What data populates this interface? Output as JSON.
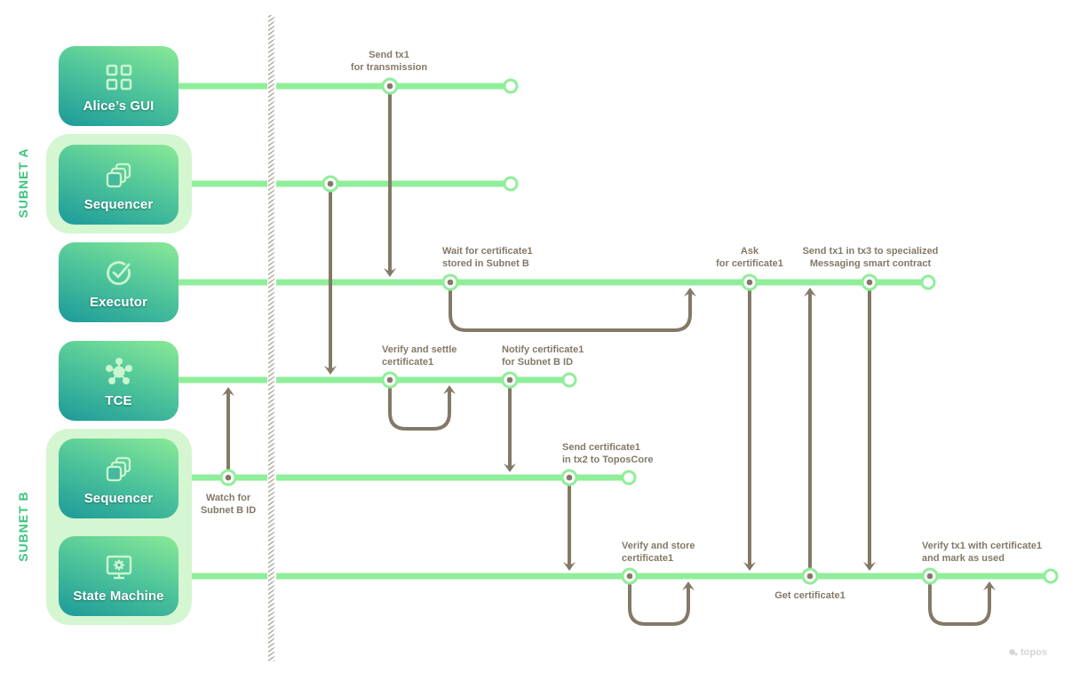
{
  "colors": {
    "lane": "#8fee9a",
    "arrow": "#837967",
    "accent": "#3cc47e",
    "group_bg": "#d4f6d0",
    "divider": "#a39c8e"
  },
  "subnets": [
    {
      "id": "subnet-a",
      "label": "SUBNET A"
    },
    {
      "id": "subnet-b",
      "label": "SUBNET B"
    }
  ],
  "actors": [
    {
      "id": "alices-gui",
      "label": "Alice’s GUI",
      "icon": "grid-icon",
      "subnet": "none"
    },
    {
      "id": "sequencer-a",
      "label": "Sequencer",
      "icon": "stack-icon",
      "subnet": "SUBNET A"
    },
    {
      "id": "executor",
      "label": "Executor",
      "icon": "check-circle-icon",
      "subnet": "none"
    },
    {
      "id": "tce",
      "label": "TCE",
      "icon": "network-hub-icon",
      "subnet": "none"
    },
    {
      "id": "sequencer-b",
      "label": "Sequencer",
      "icon": "stack-icon",
      "subnet": "SUBNET B"
    },
    {
      "id": "state-machine",
      "label": "State Machine",
      "icon": "monitor-gear-icon",
      "subnet": "SUBNET B"
    }
  ],
  "steps": [
    {
      "id": "send-tx1",
      "lane": "Alice’s GUI",
      "lines": [
        "Send tx1",
        "for transmission"
      ]
    },
    {
      "id": "wait-cert",
      "lane": "Executor",
      "lines": [
        "Wait for certificate1",
        "stored in Subnet B"
      ]
    },
    {
      "id": "ask-cert",
      "lane": "Executor",
      "lines": [
        "Ask",
        "for certificate1"
      ]
    },
    {
      "id": "send-tx3",
      "lane": "Executor",
      "lines": [
        "Send tx1 in tx3 to specialized",
        "Messaging smart contract"
      ]
    },
    {
      "id": "verify-settle",
      "lane": "TCE",
      "lines": [
        "Verify and settle",
        "certificate1"
      ]
    },
    {
      "id": "notify-cert",
      "lane": "TCE",
      "lines": [
        "Notify certificate1",
        "for Subnet B ID"
      ]
    },
    {
      "id": "watch-subnet",
      "lane": "Sequencer (Subnet B)",
      "lines": [
        "Watch for",
        "Subnet B ID"
      ]
    },
    {
      "id": "send-cert-tx2",
      "lane": "Sequencer (Subnet B)",
      "lines": [
        "Send certificate1",
        "in tx2 to ToposCore"
      ]
    },
    {
      "id": "verify-store",
      "lane": "State Machine",
      "lines": [
        "Verify and store",
        "certificate1"
      ]
    },
    {
      "id": "get-cert",
      "lane": "State Machine",
      "lines": [
        "Get certificate1"
      ]
    },
    {
      "id": "verify-tx1",
      "lane": "State Machine",
      "lines": [
        "Verify tx1 with certificate1",
        "and mark as used"
      ]
    }
  ],
  "watermark": {
    "text": "topos",
    "icon": "topos-logo-icon"
  }
}
